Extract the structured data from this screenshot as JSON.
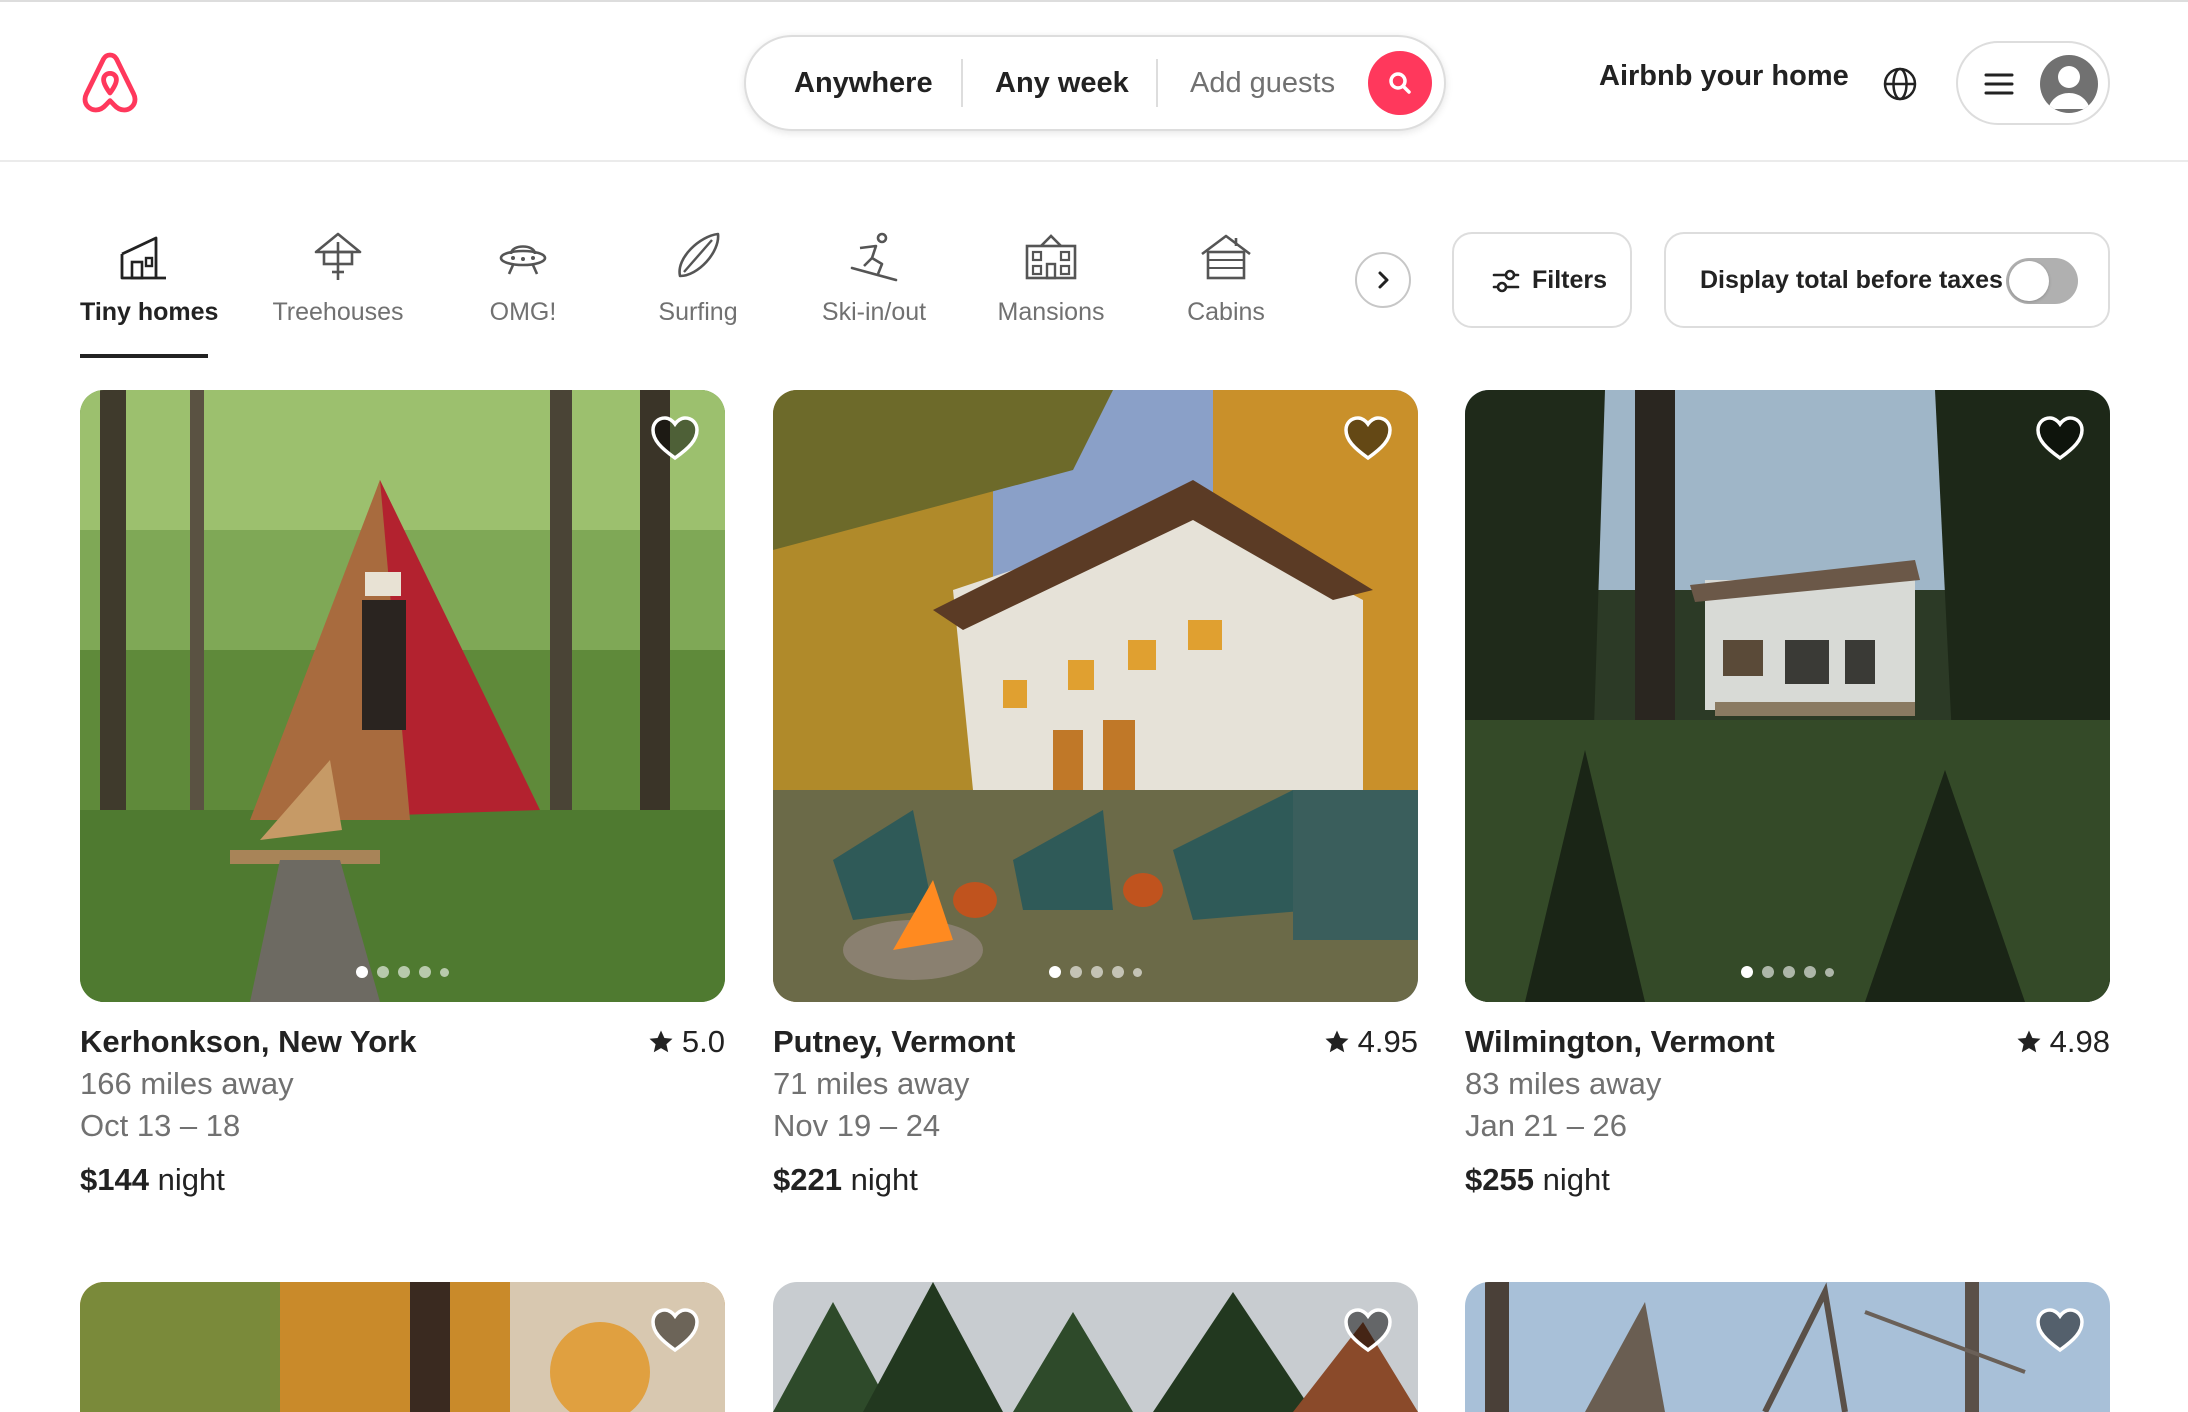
{
  "header": {
    "search": {
      "location": "Anywhere",
      "when": "Any week",
      "guests": "Add guests"
    },
    "host_link": "Airbnb your home",
    "brand_color": "#FF385C"
  },
  "categories": [
    {
      "label": "Tiny homes",
      "icon": "tiny-home-icon",
      "active": true
    },
    {
      "label": "Treehouses",
      "icon": "treehouse-icon"
    },
    {
      "label": "OMG!",
      "icon": "ufo-icon"
    },
    {
      "label": "Surfing",
      "icon": "surfboard-icon"
    },
    {
      "label": "Ski-in/out",
      "icon": "skier-icon"
    },
    {
      "label": "Mansions",
      "icon": "mansion-icon"
    },
    {
      "label": "Cabins",
      "icon": "cabin-icon"
    }
  ],
  "filters": {
    "label": "Filters"
  },
  "taxes_toggle": {
    "label": "Display total before taxes",
    "on": false
  },
  "listings": [
    {
      "title": "Kerhonkson, New York",
      "rating": "5.0",
      "distance": "166 miles away",
      "dates": "Oct 13 – 18",
      "price": "$144",
      "price_unit": "night",
      "photo_index": 1,
      "photo_count": 5
    },
    {
      "title": "Putney, Vermont",
      "rating": "4.95",
      "distance": "71 miles away",
      "dates": "Nov 19 – 24",
      "price": "$221",
      "price_unit": "night",
      "photo_index": 1,
      "photo_count": 5
    },
    {
      "title": "Wilmington, Vermont",
      "rating": "4.98",
      "distance": "83 miles away",
      "dates": "Jan 21 – 26",
      "price": "$255",
      "price_unit": "night",
      "photo_index": 1,
      "photo_count": 5
    }
  ]
}
